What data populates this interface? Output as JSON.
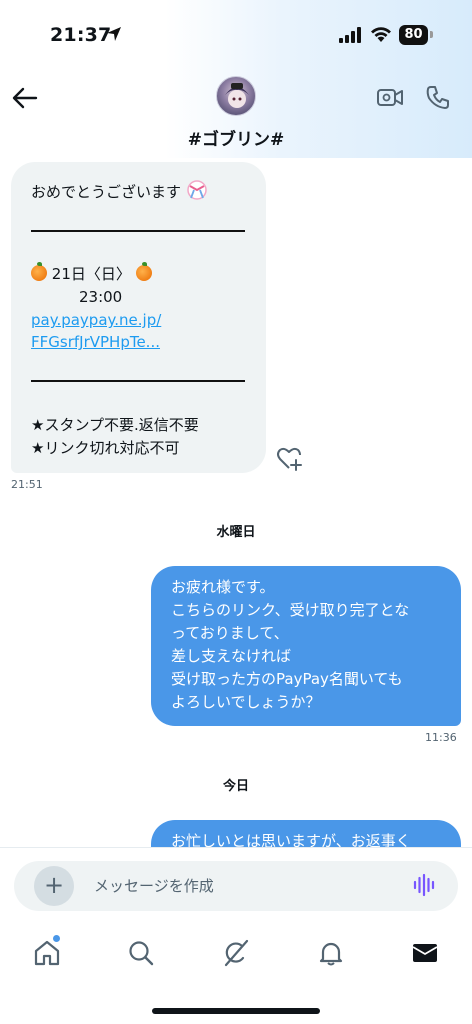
{
  "status_bar": {
    "time": "21:37",
    "battery": "80"
  },
  "header": {
    "title": "#ゴブリン#"
  },
  "messages": {
    "incoming": {
      "greeting": "おめでとうございます",
      "date_line": "21日〈日〉",
      "time_line": "23:00",
      "link_line1": "pay.paypay.ne.jp/",
      "link_line2": "FFGsrfJrVPHpTe...",
      "note1": "★スタンプ不要.返信不要",
      "note2": "★リンク切れ対応不可",
      "timestamp": "21:51"
    },
    "day_separator_1": "水曜日",
    "outgoing": {
      "line1": "お疲れ様です。",
      "line2": "こちらのリンク、受け取り完了とな",
      "line3": "っておりまして、",
      "line4": "差し支えなければ",
      "line5": "受け取った方のPayPay名聞いても",
      "line6": "よろしいでしょうか？",
      "timestamp": "11:36"
    },
    "day_separator_2": "今日",
    "outgoing_partial": {
      "line1": "お忙しいとは思いますが、お返事く"
    }
  },
  "composer": {
    "placeholder": "メッセージを作成"
  },
  "icons": {
    "back": "arrow-left-icon",
    "video": "video-camera-icon",
    "phone": "phone-icon",
    "react": "heart-plus-icon",
    "plus": "plus-icon",
    "voice": "voice-wave-icon",
    "home": "home-icon",
    "search": "search-icon",
    "grok": "grok-icon",
    "notifications": "bell-icon",
    "messages": "envelope-icon"
  },
  "colors": {
    "accent": "#4a97e8",
    "link": "#1d9bf0",
    "incoming_bubble": "#eff3f4",
    "voice": "#7856ff"
  }
}
